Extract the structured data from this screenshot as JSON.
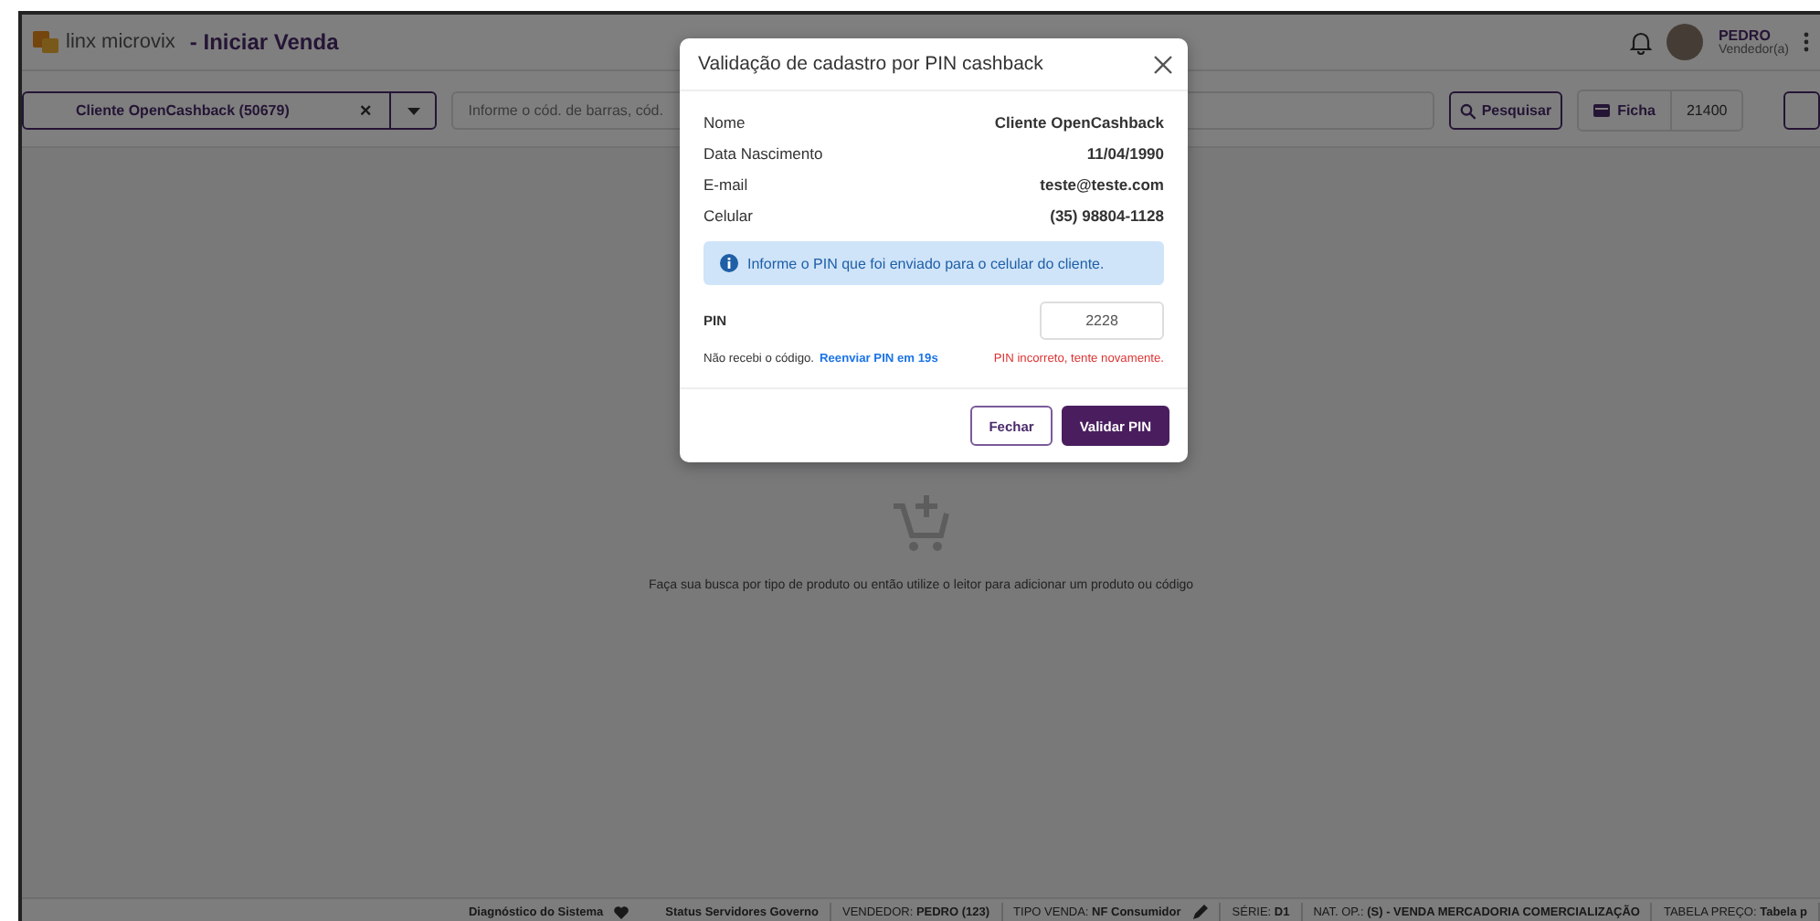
{
  "header": {
    "brand": "linx microvix",
    "page_title": "- Iniciar Venda",
    "user": {
      "name": "PEDRO",
      "role": "Vendedor(a)"
    }
  },
  "toolbar": {
    "customer": "Cliente OpenCashback (50679)",
    "clear": "×",
    "search_placeholder": "Informe o cód. de barras, cód.",
    "search_button": "Pesquisar",
    "ficha_label": "Ficha",
    "ficha_value": "21400"
  },
  "empty_state": {
    "message": "Faça sua busca por tipo de produto ou então utilize o leitor para adicionar um produto ou código"
  },
  "status_bar": [
    {
      "kind": "link",
      "text": "Diagnóstico do Sistema"
    },
    {
      "kind": "link",
      "text": "Status Servidores Governo"
    },
    {
      "kind": "field",
      "text": "VENDEDOR: **PEDRO (123)**"
    },
    {
      "kind": "edit",
      "text": "TIPO VENDA: **NF Consumidor**"
    },
    {
      "kind": "field",
      "text": "SÉRIE: **D1**"
    },
    {
      "kind": "field",
      "text": "NAT. OP.: **(S) - VENDA MERCADORIA COMERCIALIZAÇÃO**"
    },
    {
      "kind": "field",
      "text": "TABELA PREÇO: **Tabela p**"
    }
  ],
  "modal": {
    "title": "Validação de cadastro por PIN cashback",
    "fields": [
      {
        "label": "Nome",
        "value": "Cliente OpenCashback"
      },
      {
        "label": "Data Nascimento",
        "value": "11/04/1990"
      },
      {
        "label": "E-mail",
        "value": "teste@teste.com"
      },
      {
        "label": "Celular",
        "value": "(35) 98804-1128"
      }
    ],
    "info": "Informe o PIN que foi enviado para o celular do cliente.",
    "pin_label": "PIN",
    "pin_value": "2228",
    "resend_text": "Não recebi o código.",
    "resend_link": "Reenviar PIN em 19s",
    "error": "PIN incorreto, tente novamente.",
    "buttons": [
      {
        "kind": "secondary",
        "label": "Fechar"
      },
      {
        "kind": "primary",
        "label": "Validar PIN"
      }
    ]
  }
}
